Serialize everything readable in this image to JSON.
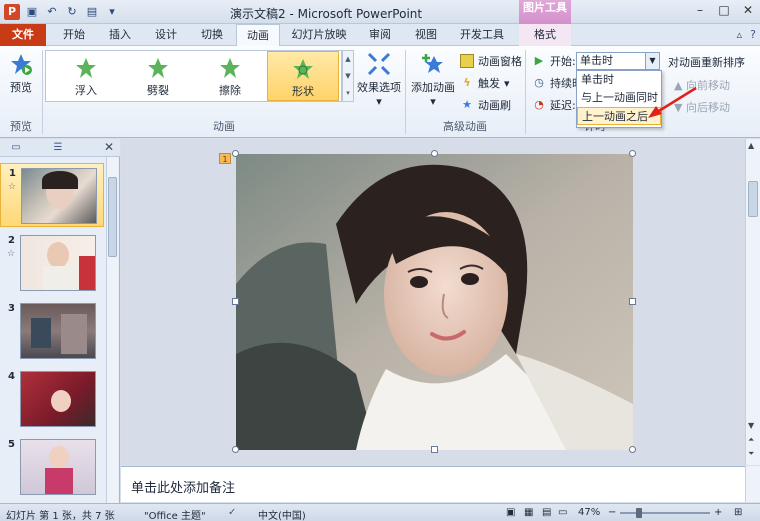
{
  "window": {
    "title": "演示文稿2 - Microsoft PowerPoint",
    "contextual_group": "图片工具",
    "app_letter": "P"
  },
  "tabs": {
    "file": "文件",
    "home": "开始",
    "insert": "插入",
    "design": "设计",
    "transitions": "切换",
    "animations": "动画",
    "slideshow": "幻灯片放映",
    "review": "审阅",
    "view": "视图",
    "developer": "开发工具",
    "format": "格式"
  },
  "ribbon": {
    "preview": {
      "label": "预览",
      "group": "预览"
    },
    "animation_group": "动画",
    "gallery": [
      {
        "label": "浮入"
      },
      {
        "label": "劈裂"
      },
      {
        "label": "擦除"
      },
      {
        "label": "形状"
      }
    ],
    "effect_options": "效果选项",
    "advanced": {
      "group": "高级动画",
      "add_animation": "添加动画",
      "animation_pane": "动画窗格",
      "trigger": "触发",
      "animation_painter": "动画刷"
    },
    "timing": {
      "start_label": "开始:",
      "start_value": "单击时",
      "duration_label": "持续时",
      "delay_label": "延迟:",
      "options": [
        "单击时",
        "与上一动画同时",
        "上一动画之后"
      ],
      "group": "计时"
    },
    "reorder": {
      "title": "对动画重新排序",
      "move_earlier": "向前移动",
      "move_later": "向后移动"
    }
  },
  "slides": [
    {
      "num": "1",
      "has_anim": true
    },
    {
      "num": "2",
      "has_anim": true
    },
    {
      "num": "3",
      "has_anim": false
    },
    {
      "num": "4",
      "has_anim": false
    },
    {
      "num": "5",
      "has_anim": false
    }
  ],
  "slide_tag": "1",
  "notes_placeholder": "单击此处添加备注",
  "status": {
    "slide_info": "幻灯片 第 1 张，共 7 张",
    "theme": "\"Office 主题\"",
    "language": "中文(中国)",
    "zoom": "47%"
  },
  "colors": {
    "file_tab": "#c83b15",
    "selected": "#ffd36b",
    "accent_arrow": "#e0201a"
  }
}
